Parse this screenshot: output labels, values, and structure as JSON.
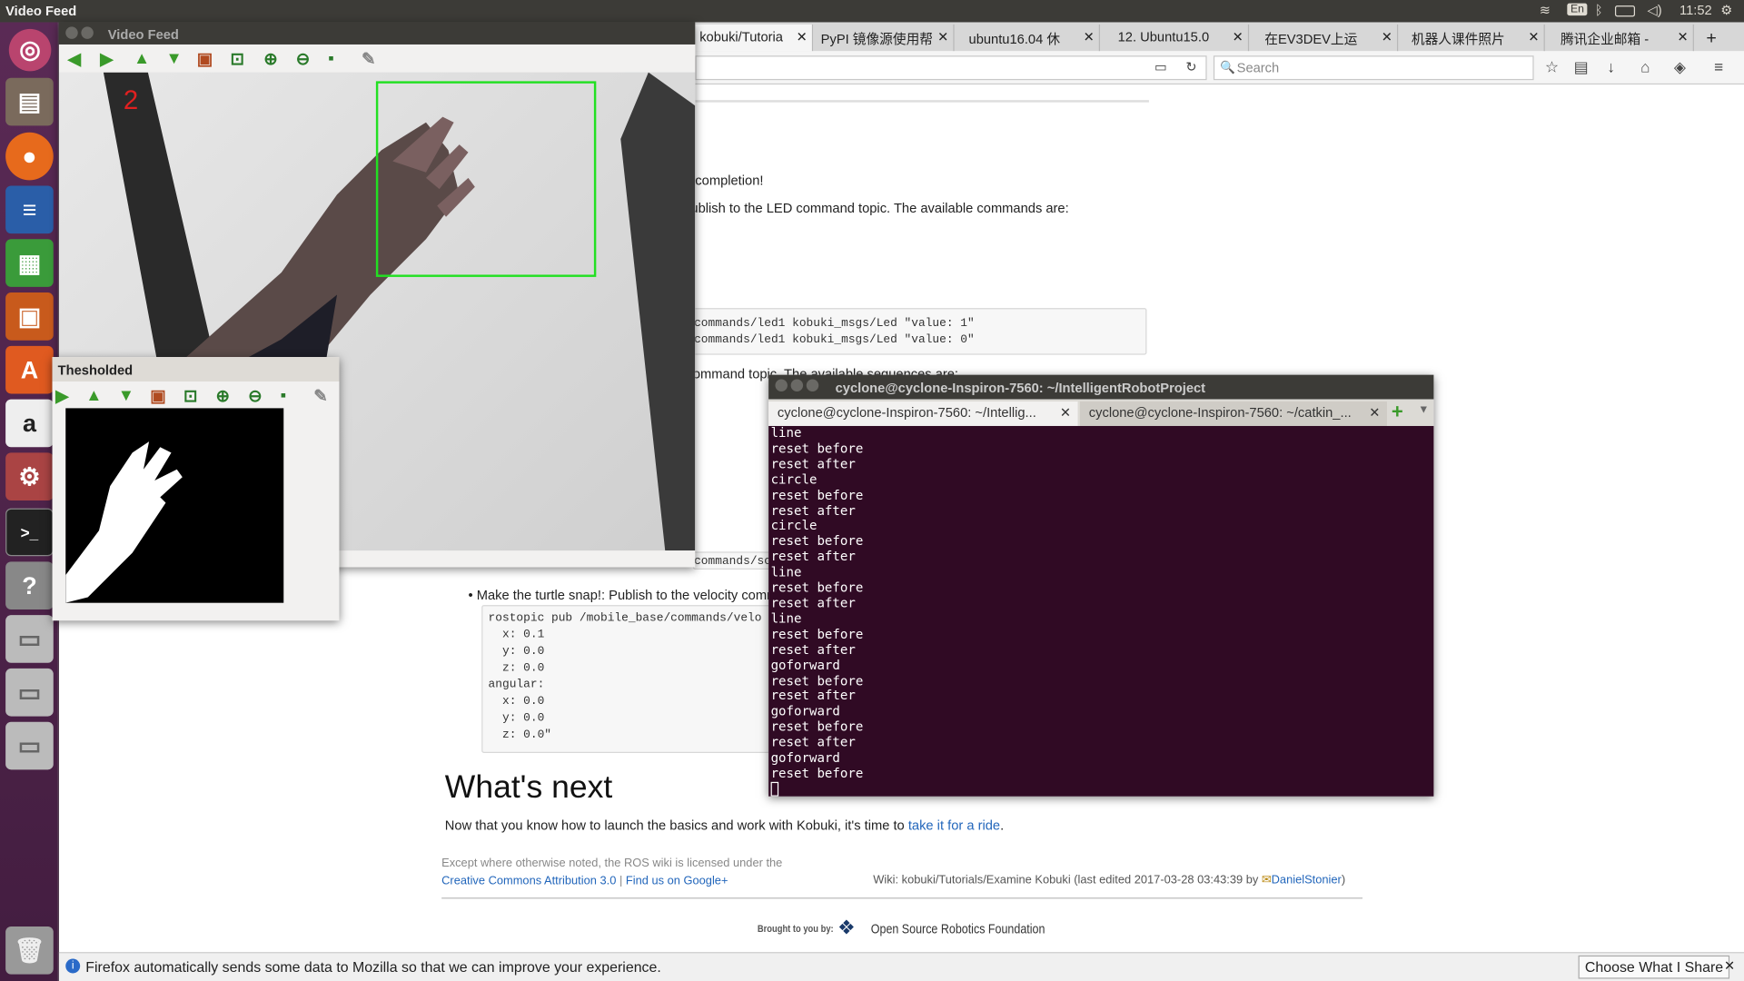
{
  "top_panel": {
    "title": "Video Feed",
    "keyboard": "En",
    "time": "11:52"
  },
  "browser": {
    "tabs": [
      {
        "label": "kobuki/Tutoria",
        "active": true
      },
      {
        "label": "PyPI 镜像源使用帮"
      },
      {
        "label": "ubuntu16.04 休"
      },
      {
        "label": "12. Ubuntu15.0"
      },
      {
        "label": "在EV3DEV上运"
      },
      {
        "label": "机器人课件照片"
      },
      {
        "label": "腾讯企业邮箱 -"
      }
    ],
    "new_tab": "+",
    "search_placeholder": "Search",
    "page": {
      "completion": "completion!",
      "led_text": "ublish to the LED command topic. The available commands are:",
      "code1_line1": "commands/led1 kobuki_msgs/Led \"value: 1\"",
      "code1_line2": "commands/led1 kobuki_msgs/Led \"value: 0\"",
      "seq_text": "ommand topic. The available sequences are:",
      "code2": "commands/so",
      "snap_bullet": "Make the turtle snap!: Publish to the velocity comm",
      "code3": [
        "rostopic pub /mobile_base/commands/velo",
        "  x: 0.1",
        "  y: 0.0",
        "  z: 0.0",
        "angular:",
        "  x: 0.0",
        "  y: 0.0",
        "  z: 0.0\""
      ],
      "whats_next": "What's next",
      "next_text": "Now that you know how to launch the basics and work with Kobuki, it's time to",
      "next_link": "take it for a ride",
      "next_end": ".",
      "license_line": "Except where otherwise noted, the ROS wiki is licensed under the",
      "license_link": "Creative Commons Attribution 3.0",
      "sep": "|",
      "google_link": "Find us on Google+",
      "wiki_info": "Wiki: kobuki/Tutorials/Examine Kobuki (last edited 2017-03-28 03:43:39 by",
      "author": "DanielStonier",
      "wiki_end": ")",
      "brought": "Brought to you by:",
      "osrf": "Open Source Robotics Foundation"
    },
    "notification": {
      "text": "Firefox automatically sends some data to Mozilla so that we can improve your experience.",
      "button": "Choose What I Share"
    }
  },
  "video_feed": {
    "title": "Video Feed",
    "count": "2"
  },
  "thresholded": {
    "title": "Thesholded"
  },
  "terminal": {
    "title": "cyclone@cyclone-Inspiron-7560: ~/IntelligentRobotProject",
    "tab1": "cyclone@cyclone-Inspiron-7560: ~/Intellig...",
    "tab2": "cyclone@cyclone-Inspiron-7560: ~/catkin_...",
    "lines": [
      "line",
      "reset before",
      "reset after",
      "circle",
      "reset before",
      "reset after",
      "circle",
      "reset before",
      "reset after",
      "line",
      "reset before",
      "reset after",
      "line",
      "reset before",
      "reset after",
      "goforward",
      "reset before",
      "reset after",
      "goforward",
      "reset before",
      "reset after",
      "goforward",
      "reset before"
    ]
  }
}
